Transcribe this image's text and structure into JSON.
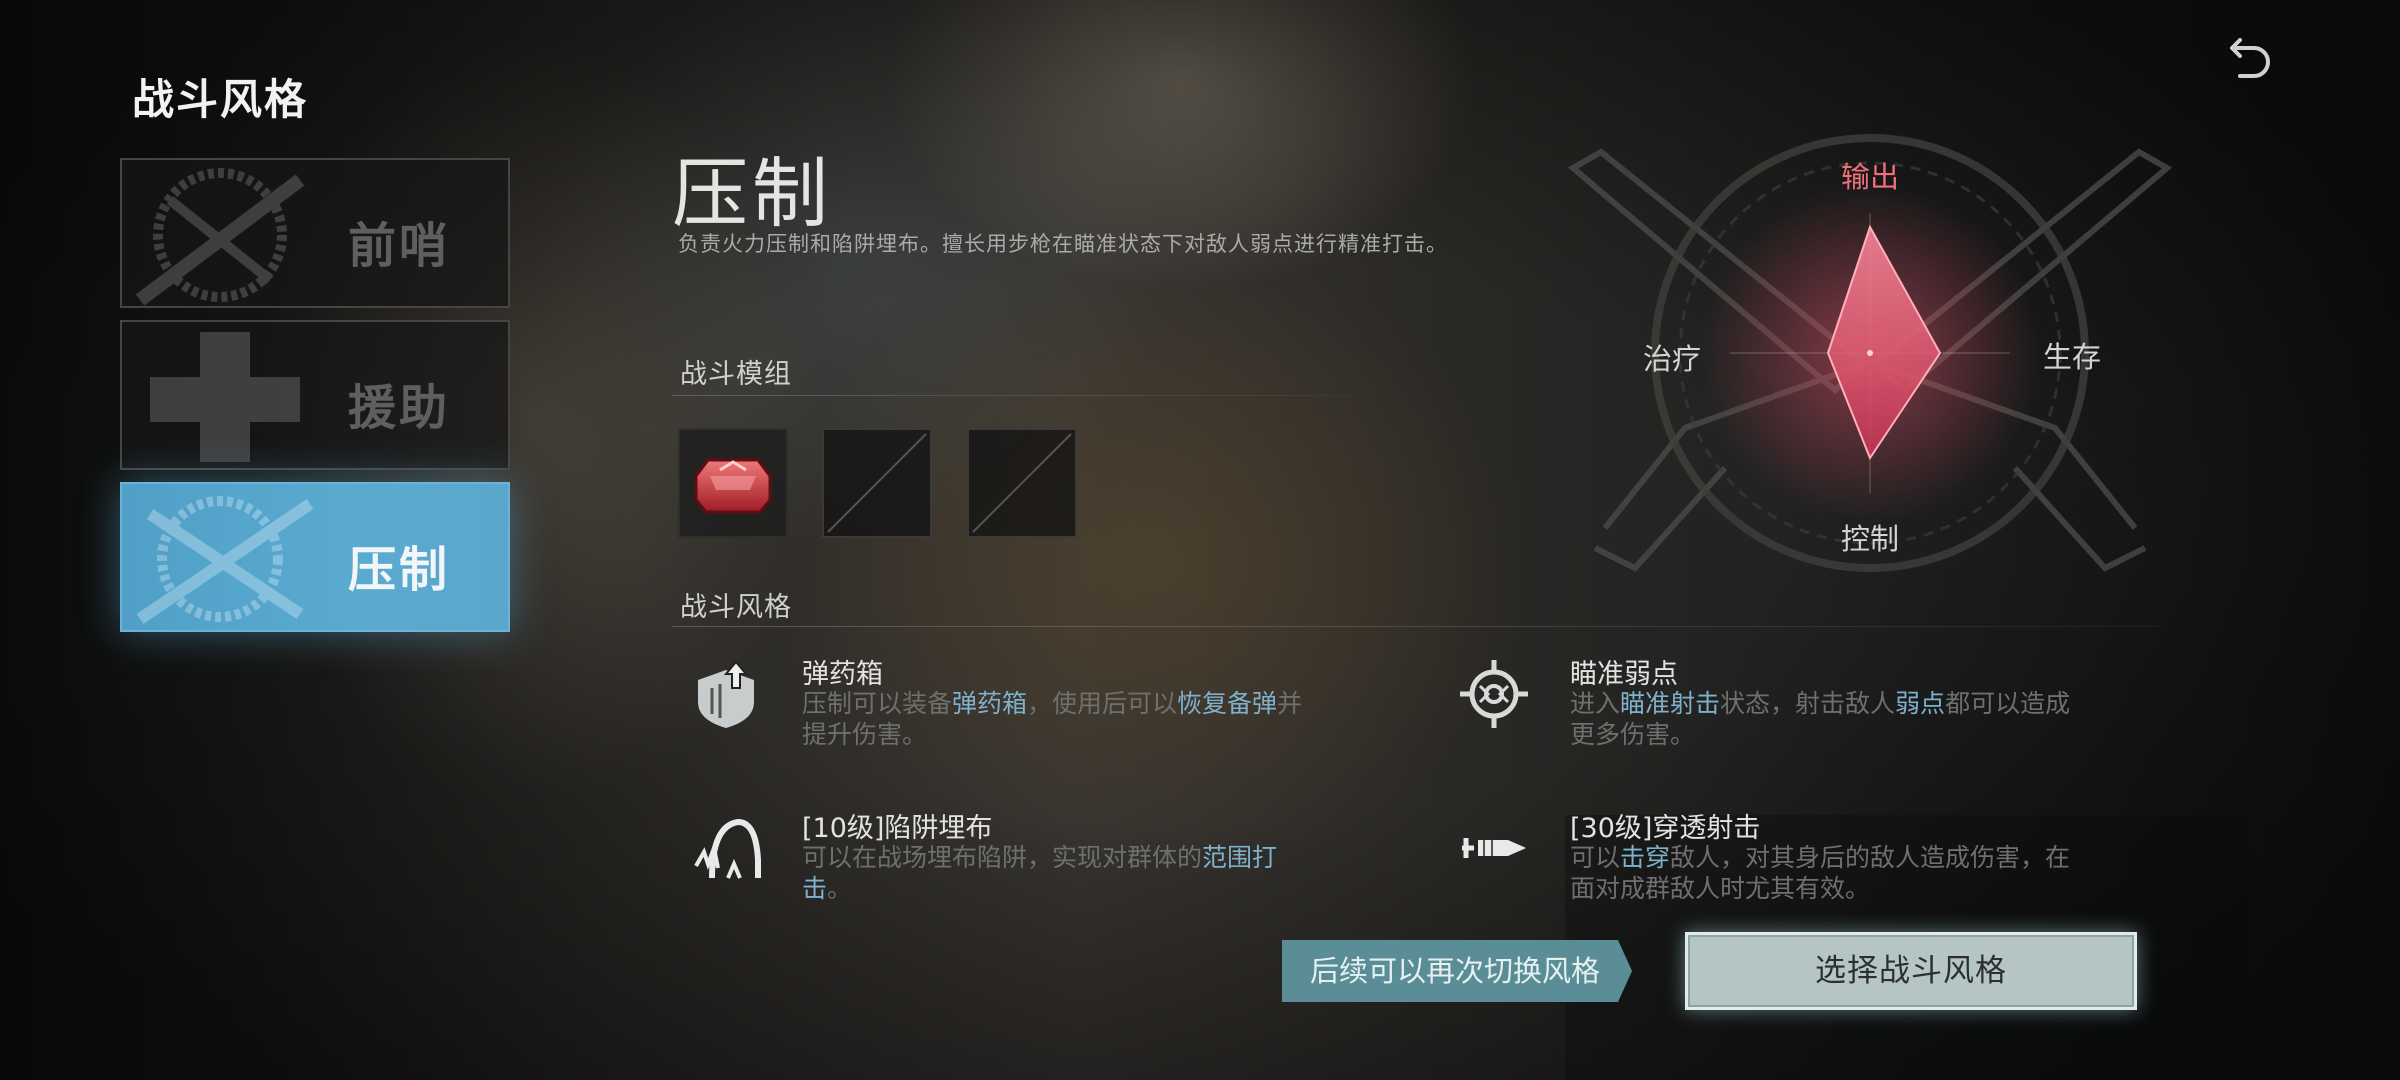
{
  "page": {
    "title": "战斗风格"
  },
  "styles": [
    {
      "label": "前哨",
      "active": false
    },
    {
      "label": "援助",
      "active": false
    },
    {
      "label": "压制",
      "active": true
    }
  ],
  "selected": {
    "name": "压制",
    "description": "负责火力压制和陷阱埋布。擅长用步枪在瞄准状态下对敌人弱点进行精准打击。"
  },
  "modules": {
    "heading": "战斗模组",
    "slots": [
      {
        "filled": true,
        "icon": "red-gem-module-icon"
      },
      {
        "filled": false,
        "icon": "empty-slot-icon"
      },
      {
        "filled": false,
        "icon": "empty-slot-icon"
      }
    ]
  },
  "features": {
    "heading": "战斗风格",
    "items": [
      {
        "icon": "ammo-box-icon",
        "title": "弹药箱",
        "desc_parts": [
          {
            "text": "压制可以装备",
            "hl": false
          },
          {
            "text": "弹药箱",
            "hl": true
          },
          {
            "text": "，使用后可以",
            "hl": false
          },
          {
            "text": "恢复备弹",
            "hl": true
          },
          {
            "text": "并提升伤害。",
            "hl": false
          }
        ]
      },
      {
        "icon": "crosshair-icon",
        "title": "瞄准弱点",
        "desc_parts": [
          {
            "text": "进入",
            "hl": false
          },
          {
            "text": "瞄准射击",
            "hl": true
          },
          {
            "text": "状态，射击敌人",
            "hl": false
          },
          {
            "text": "弱点",
            "hl": true
          },
          {
            "text": "都可以造成更多伤害。",
            "hl": false
          }
        ]
      },
      {
        "icon": "trap-icon",
        "title": "[10级]陷阱埋布",
        "desc_parts": [
          {
            "text": "可以在战场埋布陷阱，实现对群体的",
            "hl": false
          },
          {
            "text": "范围打击",
            "hl": true
          },
          {
            "text": "。",
            "hl": false
          }
        ]
      },
      {
        "icon": "piercing-bullet-icon",
        "title": "[30级]穿透射击",
        "desc_parts": [
          {
            "text": "可以",
            "hl": false
          },
          {
            "text": "击穿",
            "hl": true
          },
          {
            "text": "敌人，对其身后的敌人造成伤害，在面对成群敌人时尤其有效。",
            "hl": false
          }
        ]
      }
    ]
  },
  "radar": {
    "top": "输出",
    "left": "治疗",
    "right": "生存",
    "bottom": "控制",
    "values": {
      "输出": 0.9,
      "生存": 0.5,
      "控制": 0.75,
      "治疗": 0.3
    },
    "color": "#e0506a"
  },
  "actions": {
    "hint": "后续可以再次切换风格",
    "select": "选择战斗风格"
  },
  "colors": {
    "accent_blue": "#5aaad0",
    "highlight_text": "#7fb0cc",
    "radar_red": "#e0506a",
    "hint_teal": "#5b8d96",
    "button_gray": "#b5c4c4"
  }
}
